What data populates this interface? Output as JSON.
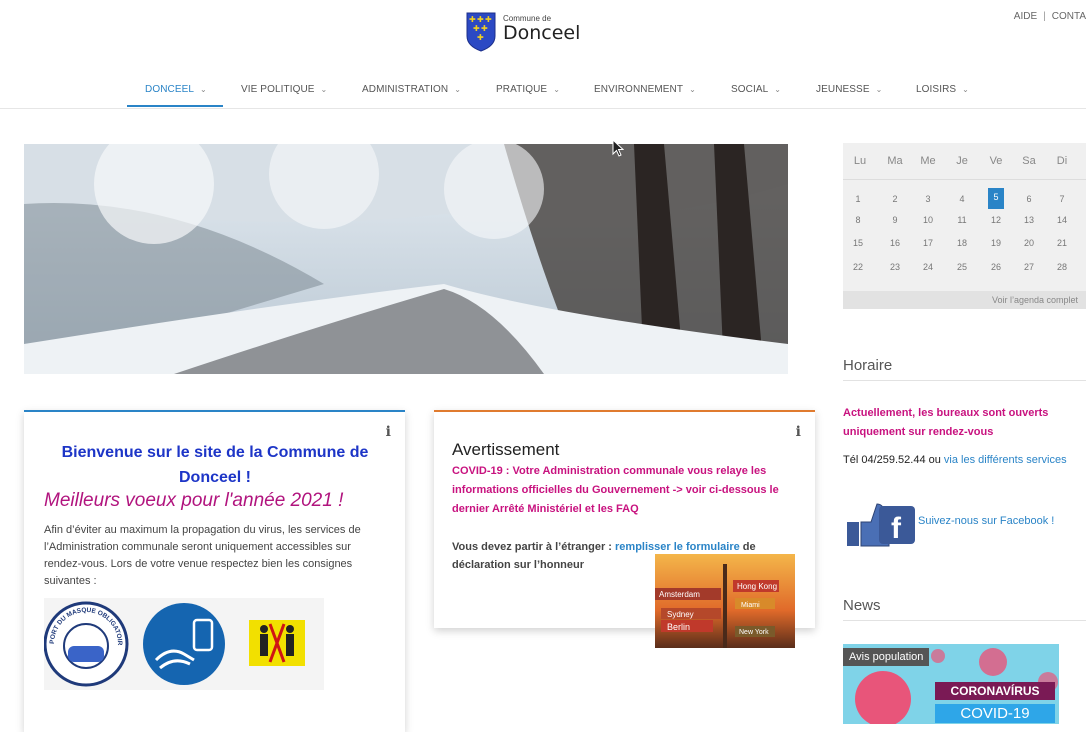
{
  "header": {
    "logo_small": "Commune de",
    "logo_big": "Donceel",
    "top_links": [
      "AIDE",
      "CONTA"
    ]
  },
  "nav": {
    "items": [
      "DONCEEL",
      "VIE POLITIQUE",
      "ADMINISTRATION",
      "PRATIQUE",
      "ENVIRONNEMENT",
      "SOCIAL",
      "JEUNESSE",
      "LOISIRS"
    ],
    "active": "DONCEEL",
    "chevron": "⌄"
  },
  "welcome": {
    "info": "i",
    "title": "Bienvenue sur le site de la Commune de Donceel !",
    "voeux": "Meilleurs voeux pour l'année 2021 !",
    "body": "Afin d’éviter au maximum la propagation du virus, les services de l’Administration communale seront uniquement accessibles sur rendez-vous. Lors de votre venue respectez bien les consignes suivantes :",
    "masque_text": "PORT DU MASQUE OBLIGATOIRE"
  },
  "warning": {
    "info": "i",
    "title": "Avertissement",
    "covid": "COVID-19 : Votre Administration communale vous relaye les informations officielles du Gouvernement -> voir ci-dessous le dernier Arrêté Ministériel et les FAQ",
    "travel_prefix": "Vous devez partir à l’étranger : ",
    "travel_link": "remplisser le formulaire",
    "travel_suffix": " de déclaration sur l’honneur",
    "signs": [
      "Hong Kong",
      "Amsterdam",
      "Sydney",
      "Berlin",
      "Miami",
      "New York"
    ]
  },
  "calendar": {
    "days": [
      "Lu",
      "Ma",
      "Me",
      "Je",
      "Ve",
      "Sa",
      "Di"
    ],
    "weeks": [
      [
        "1",
        "2",
        "3",
        "4",
        "5",
        "6",
        "7"
      ],
      [
        "8",
        "9",
        "10",
        "11",
        "12",
        "13",
        "14"
      ],
      [
        "15",
        "16",
        "17",
        "18",
        "19",
        "20",
        "21"
      ],
      [
        "22",
        "23",
        "24",
        "25",
        "26",
        "27",
        "28"
      ]
    ],
    "today": "5",
    "footer_link": "Voir l’agenda complet"
  },
  "horaire": {
    "title": "Horaire",
    "open_text": "Actuellement, les bureaux sont ouverts uniquement sur rendez-vous",
    "tel_prefix": "Tél 04/259.52.44 ou ",
    "tel_link": "via les différents services",
    "facebook": "Suivez-nous sur Facebook !"
  },
  "news": {
    "title": "News",
    "badge": "Avis population",
    "corona": "CORONAVÍRUS",
    "covid": "COVID-19"
  },
  "colors": {
    "accent_blue": "#2a84c7",
    "magenta": "#c8127f",
    "title_blue": "#1d35c7"
  }
}
